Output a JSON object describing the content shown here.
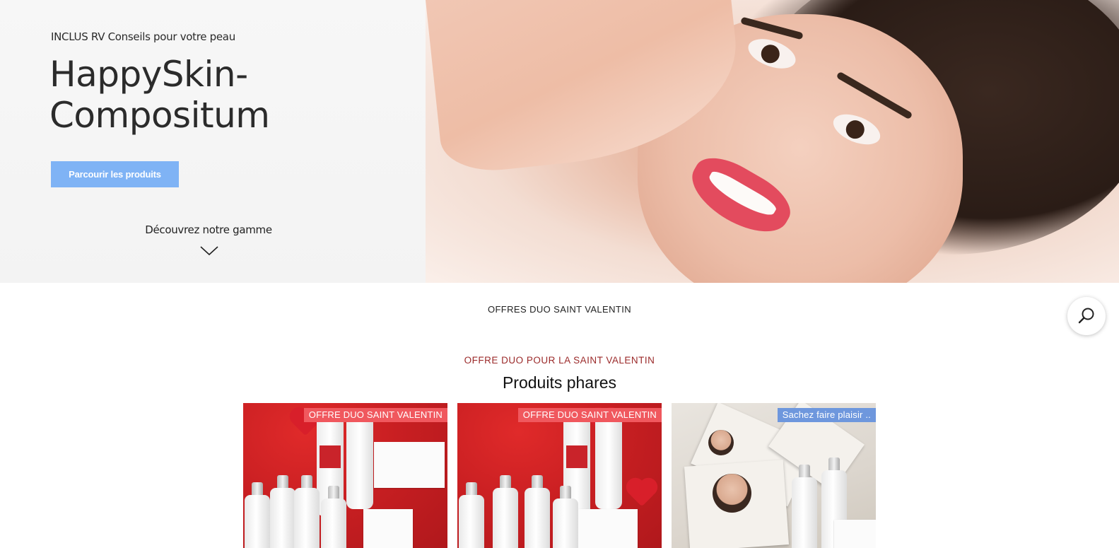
{
  "hero": {
    "eyebrow": "INCLUS RV Conseils pour votre peau",
    "title": "HappySkin-Compositum",
    "cta_label": "Parcourir les produits",
    "discover_label": "Découvrez notre gamme",
    "cta_color": "#7fb3f5"
  },
  "section": {
    "nav_label": "OFFRES DUO SAINT VALENTIN",
    "offer_label": "OFFRE DUO POUR LA SAINT VALENTIN",
    "title": "Produits phares",
    "offer_color": "#9b2a2a"
  },
  "products": [
    {
      "badge": "OFFRE DUO SAINT VALENTIN",
      "badge_color": "#f0585e"
    },
    {
      "badge": "OFFRE DUO SAINT VALENTIN",
      "badge_color": "#f0585e"
    },
    {
      "badge": "Sachez faire plaisir ..",
      "badge_color": "#6e97dd"
    }
  ],
  "icons": {
    "discover": "chevron-down-icon",
    "search": "search-icon"
  }
}
